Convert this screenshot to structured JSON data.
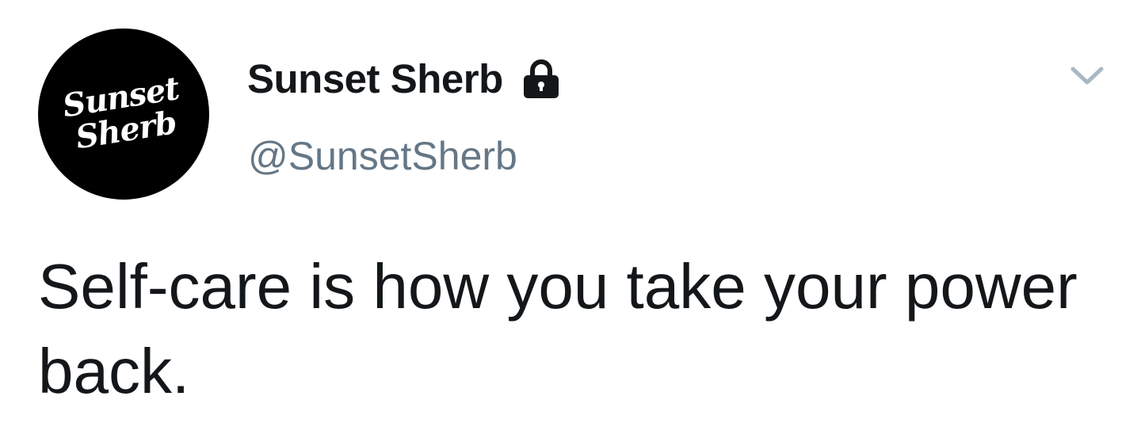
{
  "profile": {
    "avatar_text": "Sunset\nSherb",
    "display_name": "Sunset Sherb",
    "handle": "@SunsetSherb",
    "protected_icon": "lock-icon"
  },
  "menu": {
    "caret_icon": "chevron-down-icon"
  },
  "tweet": {
    "text": "Self-care is how you take your power back."
  },
  "colors": {
    "text_primary": "#14171a",
    "text_secondary": "#657786",
    "caret": "#aab8c2",
    "avatar_bg": "#000000"
  }
}
